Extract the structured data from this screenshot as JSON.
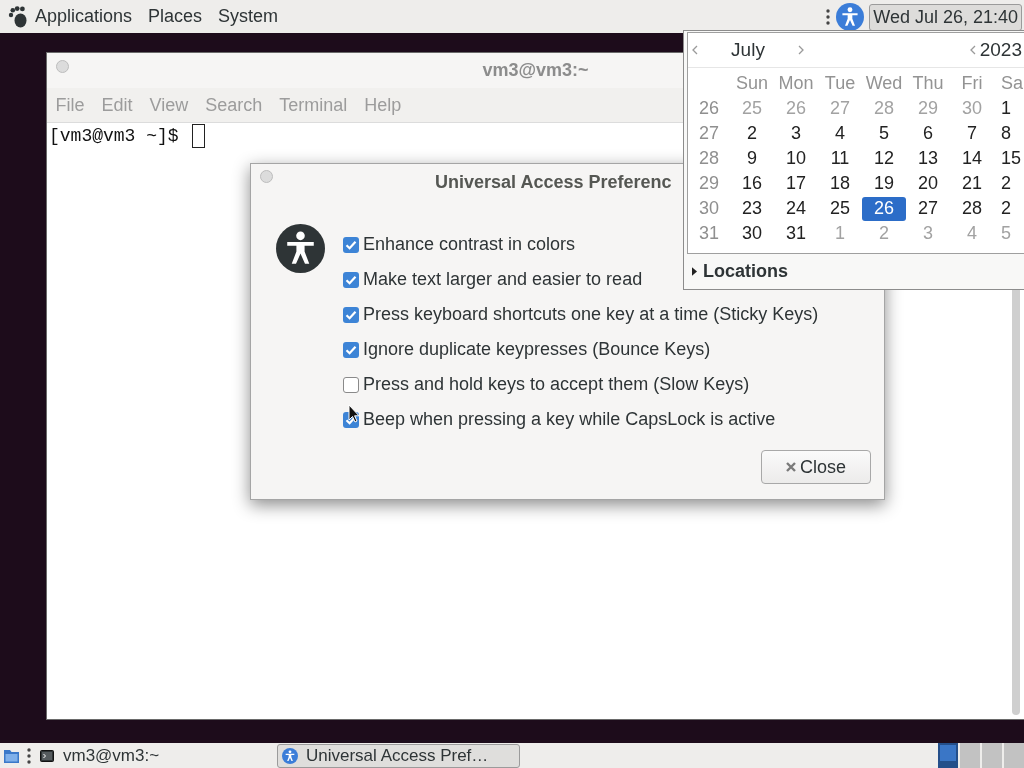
{
  "top_panel": {
    "menus": [
      {
        "label": "Applications",
        "kind": "logo"
      },
      {
        "label": "Places",
        "kind": "text"
      },
      {
        "label": "System",
        "kind": "text"
      }
    ],
    "clock": {
      "label": "Wed Jul 26, 21:40",
      "pressed": true
    }
  },
  "terminal": {
    "title": "vm3@vm3:~",
    "menu": [
      "File",
      "Edit",
      "View",
      "Search",
      "Terminal",
      "Help"
    ],
    "prompt": "[vm3@vm3 ~]$"
  },
  "dialog": {
    "title": "Universal Access Preferenc",
    "options": [
      {
        "label": "Enhance contrast in colors",
        "checked": true
      },
      {
        "label": "Make text larger and easier to read",
        "checked": true
      },
      {
        "label": "Press keyboard shortcuts one key at a time (Sticky Keys)",
        "checked": true
      },
      {
        "label": "Ignore duplicate keypresses (Bounce Keys)",
        "checked": true
      },
      {
        "label": "Press and hold keys to accept them (Slow Keys)",
        "checked": false
      },
      {
        "label": "Beep when pressing a key while CapsLock is active",
        "checked": true
      }
    ],
    "close_button": "Close"
  },
  "calendar": {
    "month": "July",
    "year": "2023",
    "weekdays": [
      "Sun",
      "Mon",
      "Tue",
      "Wed",
      "Thu",
      "Fri",
      "Sa"
    ],
    "weeks": [
      {
        "week": "26",
        "days": [
          {
            "day": "25",
            "other_month": true,
            "selected": false
          },
          {
            "day": "26",
            "other_month": true,
            "selected": false
          },
          {
            "day": "27",
            "other_month": true,
            "selected": false
          },
          {
            "day": "28",
            "other_month": true,
            "selected": false
          },
          {
            "day": "29",
            "other_month": true,
            "selected": false
          },
          {
            "day": "30",
            "other_month": true,
            "selected": false
          },
          {
            "day": "1",
            "other_month": false,
            "selected": false
          }
        ]
      },
      {
        "week": "27",
        "days": [
          {
            "day": "2",
            "other_month": false,
            "selected": false
          },
          {
            "day": "3",
            "other_month": false,
            "selected": false
          },
          {
            "day": "4",
            "other_month": false,
            "selected": false
          },
          {
            "day": "5",
            "other_month": false,
            "selected": false
          },
          {
            "day": "6",
            "other_month": false,
            "selected": false
          },
          {
            "day": "7",
            "other_month": false,
            "selected": false
          },
          {
            "day": "8",
            "other_month": false,
            "selected": false
          }
        ]
      },
      {
        "week": "28",
        "days": [
          {
            "day": "9",
            "other_month": false,
            "selected": false
          },
          {
            "day": "10",
            "other_month": false,
            "selected": false
          },
          {
            "day": "11",
            "other_month": false,
            "selected": false
          },
          {
            "day": "12",
            "other_month": false,
            "selected": false
          },
          {
            "day": "13",
            "other_month": false,
            "selected": false
          },
          {
            "day": "14",
            "other_month": false,
            "selected": false
          },
          {
            "day": "15",
            "other_month": false,
            "selected": false
          }
        ]
      },
      {
        "week": "29",
        "days": [
          {
            "day": "16",
            "other_month": false,
            "selected": false
          },
          {
            "day": "17",
            "other_month": false,
            "selected": false
          },
          {
            "day": "18",
            "other_month": false,
            "selected": false
          },
          {
            "day": "19",
            "other_month": false,
            "selected": false
          },
          {
            "day": "20",
            "other_month": false,
            "selected": false
          },
          {
            "day": "21",
            "other_month": false,
            "selected": false
          },
          {
            "day": "2",
            "other_month": false,
            "selected": false
          }
        ]
      },
      {
        "week": "30",
        "days": [
          {
            "day": "23",
            "other_month": false,
            "selected": false
          },
          {
            "day": "24",
            "other_month": false,
            "selected": false
          },
          {
            "day": "25",
            "other_month": false,
            "selected": false
          },
          {
            "day": "26",
            "other_month": false,
            "selected": true
          },
          {
            "day": "27",
            "other_month": false,
            "selected": false
          },
          {
            "day": "28",
            "other_month": false,
            "selected": false
          },
          {
            "day": "2",
            "other_month": false,
            "selected": false
          }
        ]
      },
      {
        "week": "31",
        "days": [
          {
            "day": "30",
            "other_month": false,
            "selected": false
          },
          {
            "day": "31",
            "other_month": false,
            "selected": false
          },
          {
            "day": "1",
            "other_month": true,
            "selected": false
          },
          {
            "day": "2",
            "other_month": true,
            "selected": false
          },
          {
            "day": "3",
            "other_month": true,
            "selected": false
          },
          {
            "day": "4",
            "other_month": true,
            "selected": false
          },
          {
            "day": "5",
            "other_month": true,
            "selected": false
          }
        ]
      }
    ],
    "locations": {
      "label": "Locations",
      "expanded": false
    }
  },
  "bottom_panel": {
    "tasks": [
      {
        "label": "vm3@vm3:~",
        "kind": "terminal",
        "selected": false
      },
      {
        "label": "Universal Access Pref…",
        "kind": "accessibility",
        "selected": true
      }
    ],
    "workspaces": [
      {
        "selected": true
      },
      {
        "selected": false
      },
      {
        "selected": false
      },
      {
        "selected": false
      }
    ]
  }
}
